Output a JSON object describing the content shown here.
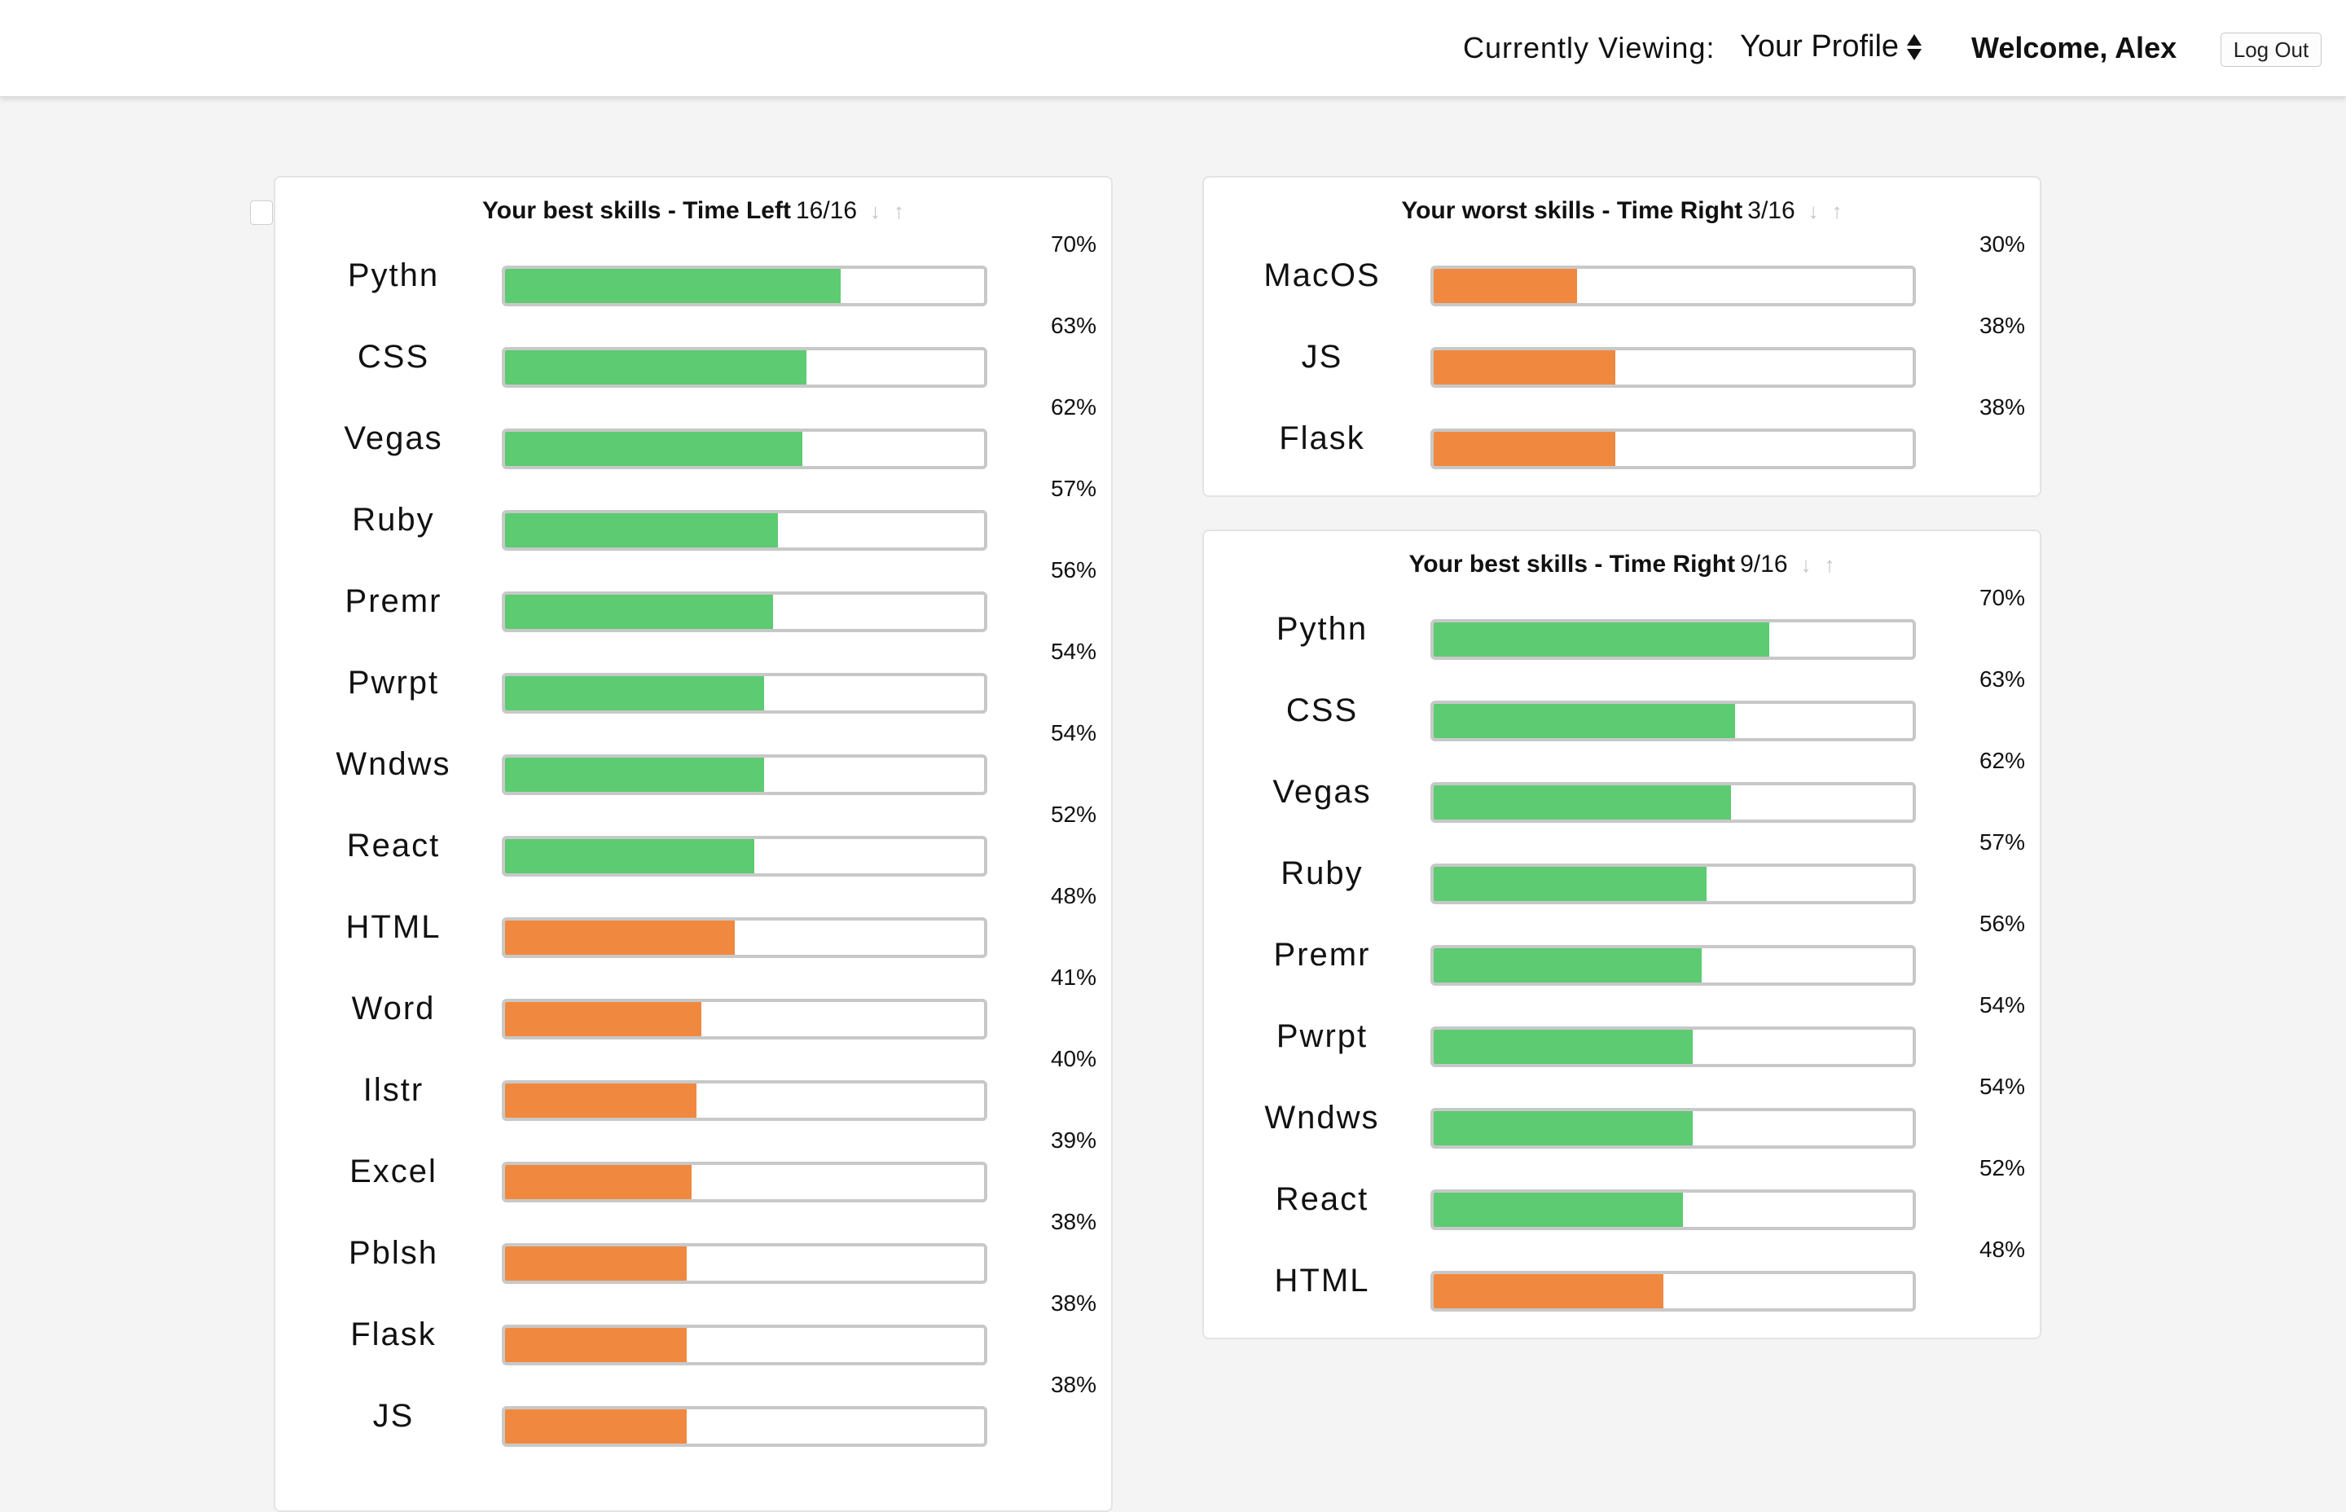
{
  "header": {
    "viewing_label": "Currently Viewing:",
    "profile_select_value": "Your Profile",
    "welcome": "Welcome, Alex",
    "logout_label": "Log Out"
  },
  "colors": {
    "good_bar": "#5ccb72",
    "weak_bar": "#f0893f"
  },
  "panels": {
    "left": {
      "title": "Your best skills - Time Left",
      "count": "16/16",
      "skills": [
        {
          "name": "Pythn",
          "pct": "70%",
          "value": 0.7,
          "level": "good"
        },
        {
          "name": "CSS",
          "pct": "63%",
          "value": 0.63,
          "level": "good"
        },
        {
          "name": "Vegas",
          "pct": "62%",
          "value": 0.62,
          "level": "good"
        },
        {
          "name": "Ruby",
          "pct": "57%",
          "value": 0.57,
          "level": "good"
        },
        {
          "name": "Premr",
          "pct": "56%",
          "value": 0.56,
          "level": "good"
        },
        {
          "name": "Pwrpt",
          "pct": "54%",
          "value": 0.54,
          "level": "good"
        },
        {
          "name": "Wndws",
          "pct": "54%",
          "value": 0.54,
          "level": "good"
        },
        {
          "name": "React",
          "pct": "52%",
          "value": 0.52,
          "level": "good"
        },
        {
          "name": "HTML",
          "pct": "48%",
          "value": 0.48,
          "level": "weak"
        },
        {
          "name": "Word",
          "pct": "41%",
          "value": 0.41,
          "level": "weak"
        },
        {
          "name": "Ilstr",
          "pct": "40%",
          "value": 0.4,
          "level": "weak"
        },
        {
          "name": "Excel",
          "pct": "39%",
          "value": 0.39,
          "level": "weak"
        },
        {
          "name": "Pblsh",
          "pct": "38%",
          "value": 0.38,
          "level": "weak"
        },
        {
          "name": "Flask",
          "pct": "38%",
          "value": 0.38,
          "level": "weak"
        },
        {
          "name": "JS",
          "pct": "38%",
          "value": 0.38,
          "level": "weak"
        }
      ]
    },
    "worst": {
      "title": "Your worst skills - Time Right",
      "count": "3/16",
      "skills": [
        {
          "name": "MacOS",
          "pct": "30%",
          "value": 0.3,
          "level": "weak"
        },
        {
          "name": "JS",
          "pct": "38%",
          "value": 0.38,
          "level": "weak"
        },
        {
          "name": "Flask",
          "pct": "38%",
          "value": 0.38,
          "level": "weak"
        }
      ]
    },
    "right": {
      "title": "Your best skills - Time Right",
      "count": "9/16",
      "skills": [
        {
          "name": "Pythn",
          "pct": "70%",
          "value": 0.7,
          "level": "good"
        },
        {
          "name": "CSS",
          "pct": "63%",
          "value": 0.63,
          "level": "good"
        },
        {
          "name": "Vegas",
          "pct": "62%",
          "value": 0.62,
          "level": "good"
        },
        {
          "name": "Ruby",
          "pct": "57%",
          "value": 0.57,
          "level": "good"
        },
        {
          "name": "Premr",
          "pct": "56%",
          "value": 0.56,
          "level": "good"
        },
        {
          "name": "Pwrpt",
          "pct": "54%",
          "value": 0.54,
          "level": "good"
        },
        {
          "name": "Wndws",
          "pct": "54%",
          "value": 0.54,
          "level": "good"
        },
        {
          "name": "React",
          "pct": "52%",
          "value": 0.52,
          "level": "good"
        },
        {
          "name": "HTML",
          "pct": "48%",
          "value": 0.48,
          "level": "weak"
        }
      ]
    }
  }
}
